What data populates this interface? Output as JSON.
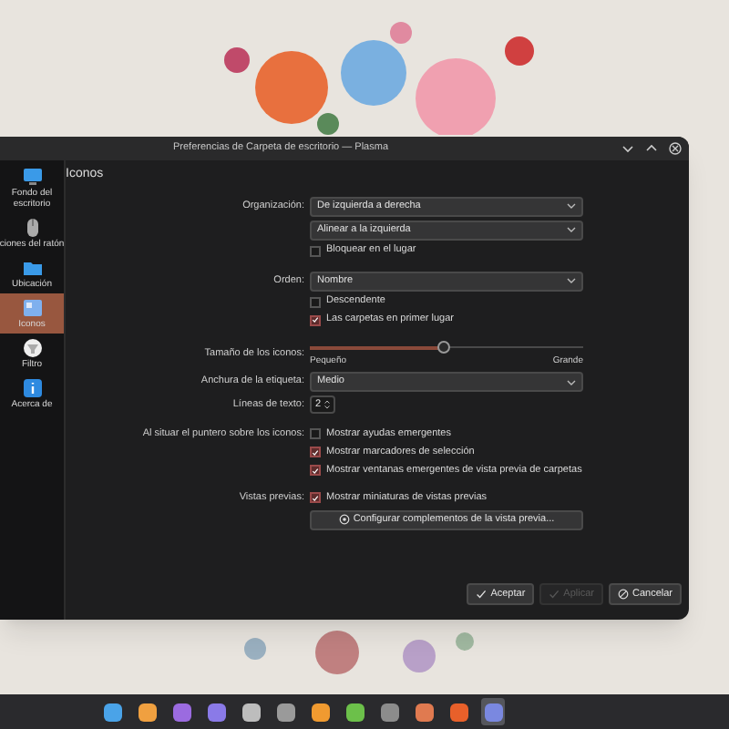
{
  "window": {
    "title": "Preferencias de Carpeta de escritorio — Plasma"
  },
  "sidebar": {
    "items": [
      {
        "kind": "monitor",
        "label": "Fondo del escritorio",
        "selected": false
      },
      {
        "kind": "mouse",
        "label": "ciones del ratón",
        "selected": false
      },
      {
        "kind": "folder",
        "label": "Ubicación",
        "selected": false
      },
      {
        "kind": "icons",
        "label": "Iconos",
        "selected": true
      },
      {
        "kind": "filter",
        "label": "Filtro",
        "selected": false
      },
      {
        "kind": "info",
        "label": "Acerca de",
        "selected": false
      }
    ]
  },
  "page": {
    "title": "Iconos"
  },
  "form": {
    "groups": [
      [
        {
          "kind": "combo",
          "label": "Organización:",
          "value": "De izquierda a derecha"
        },
        {
          "kind": "combo",
          "value": "Alinear a la izquierda"
        },
        {
          "kind": "checkbox",
          "text": "Bloquear en el lugar",
          "checked": false
        }
      ],
      [
        {
          "kind": "combo",
          "label": "Orden:",
          "value": "Nombre"
        },
        {
          "kind": "checkbox",
          "text": "Descendente",
          "checked": false
        },
        {
          "kind": "checkbox",
          "text": "Las carpetas en primer lugar",
          "checked": true
        }
      ],
      [
        {
          "kind": "slider",
          "label": "Tamaño de los iconos:",
          "level": 0.49,
          "min_label": "Pequeño",
          "max_label": "Grande"
        },
        {
          "kind": "combo",
          "label": "Anchura de la etiqueta:",
          "value": "Medio"
        },
        {
          "kind": "spin",
          "label": "Líneas de texto:",
          "value": "2"
        }
      ],
      [
        {
          "kind": "checkbox",
          "label": "Al situar el puntero sobre los iconos:",
          "text": "Mostrar ayudas emergentes",
          "checked": false
        },
        {
          "kind": "checkbox",
          "text": "Mostrar marcadores de selección",
          "checked": true
        },
        {
          "kind": "checkbox",
          "text": "Mostrar ventanas emergentes de vista previa de carpetas",
          "checked": true
        }
      ],
      [
        {
          "kind": "checkbox",
          "label": "Vistas previas:",
          "text": "Mostrar miniaturas de vistas previas",
          "checked": true
        },
        {
          "kind": "button",
          "text": "Configurar complementos de la vista previa..."
        }
      ]
    ]
  },
  "buttons": [
    {
      "kind": "accept",
      "label": "Aceptar",
      "disabled": false
    },
    {
      "kind": "apply",
      "label": "Aplicar",
      "disabled": true
    },
    {
      "kind": "cancel",
      "label": "Cancelar",
      "disabled": false
    }
  ],
  "taskbar": {
    "apps": [
      {
        "color": "#4aa3e8",
        "selected": false
      },
      {
        "color": "#f0a040",
        "selected": false
      },
      {
        "color": "#9b6be0",
        "selected": false
      },
      {
        "color": "#8a7ae8",
        "selected": false
      },
      {
        "color": "#bdbdbd",
        "selected": false
      },
      {
        "color": "#9a9a9a",
        "selected": false
      },
      {
        "color": "#f09a30",
        "selected": false
      },
      {
        "color": "#6cc04a",
        "selected": false
      },
      {
        "color": "#8c8c8c",
        "selected": false
      },
      {
        "color": "#e07a50",
        "selected": false
      },
      {
        "color": "#e8602a",
        "selected": false
      },
      {
        "color": "#7a88e0",
        "selected": true
      }
    ]
  }
}
